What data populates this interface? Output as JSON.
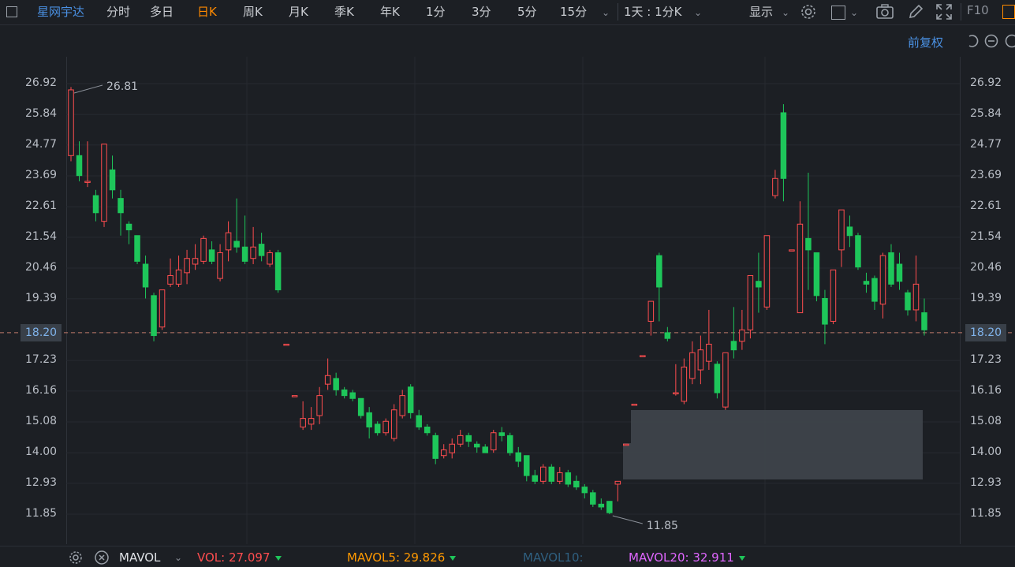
{
  "toolbar": {
    "stock_name": "星网宇达",
    "periods": [
      "分时",
      "多日",
      "日K",
      "周K",
      "月K",
      "季K",
      "年K",
      "1分",
      "3分",
      "5分",
      "15分"
    ],
    "active_period": "日K",
    "combo": "1天 : 1分K",
    "display": "显示",
    "f10": "F10"
  },
  "subbar": {
    "adjust": "前复权"
  },
  "price": {
    "current_label": "18.20",
    "ticks": [
      "26.92",
      "25.84",
      "24.77",
      "23.69",
      "22.61",
      "21.54",
      "20.46",
      "19.39",
      "18.20",
      "17.23",
      "16.16",
      "15.08",
      "14.00",
      "12.93",
      "11.85"
    ],
    "high_label": "26.81",
    "low_label": "11.85"
  },
  "indicator": {
    "name": "MAVOL",
    "vol_label": "VOL:",
    "vol_value": "27.097",
    "mavol5_label": "MAVOL5:",
    "mavol5_value": "29.826",
    "mavol10_label": "MAVOL10:",
    "mavol20_label": "MAVOL20:",
    "mavol20_value": "32.911"
  },
  "colors": {
    "up": "#ff4d4f",
    "down": "#1ec65a",
    "active": "#ff8a00",
    "stock": "#4a90e2",
    "mavol5": "#ff9900",
    "mavol10": "#2f5f7f",
    "mavol20": "#e066ff"
  },
  "chart_data": {
    "type": "candlestick",
    "ylim": [
      11.2,
      27.5
    ],
    "current_price": 18.2,
    "high": 26.81,
    "low": 11.85,
    "candles": [
      {
        "o": 24.4,
        "c": 26.7,
        "h": 26.8,
        "l": 24.2
      },
      {
        "o": 24.4,
        "c": 23.7,
        "h": 24.9,
        "l": 23.5
      },
      {
        "o": 23.5,
        "c": 23.5,
        "h": 24.9,
        "l": 23.3
      },
      {
        "o": 23.0,
        "c": 22.4,
        "h": 23.2,
        "l": 22.1
      },
      {
        "o": 22.1,
        "c": 24.8,
        "h": 24.8,
        "l": 21.9
      },
      {
        "o": 23.9,
        "c": 23.2,
        "h": 24.4,
        "l": 22.9
      },
      {
        "o": 22.9,
        "c": 22.4,
        "h": 23.2,
        "l": 21.6
      },
      {
        "o": 22.0,
        "c": 21.8,
        "h": 22.1,
        "l": 21.3
      },
      {
        "o": 21.6,
        "c": 20.7,
        "h": 21.6,
        "l": 20.6
      },
      {
        "o": 20.6,
        "c": 19.8,
        "h": 20.9,
        "l": 19.4
      },
      {
        "o": 19.5,
        "c": 18.1,
        "h": 19.6,
        "l": 17.9
      },
      {
        "o": 18.4,
        "c": 19.7,
        "h": 19.7,
        "l": 18.3
      },
      {
        "o": 19.9,
        "c": 20.2,
        "h": 20.8,
        "l": 19.8
      },
      {
        "o": 19.9,
        "c": 20.4,
        "h": 20.9,
        "l": 19.8
      },
      {
        "o": 20.3,
        "c": 20.8,
        "h": 21.1,
        "l": 19.9
      },
      {
        "o": 20.6,
        "c": 20.8,
        "h": 21.3,
        "l": 20.4
      },
      {
        "o": 20.7,
        "c": 21.5,
        "h": 21.6,
        "l": 20.6
      },
      {
        "o": 21.1,
        "c": 20.7,
        "h": 21.4,
        "l": 20.6
      },
      {
        "o": 20.1,
        "c": 21.0,
        "h": 21.3,
        "l": 20.0
      },
      {
        "o": 21.1,
        "c": 21.7,
        "h": 22.1,
        "l": 20.7
      },
      {
        "o": 21.4,
        "c": 21.2,
        "h": 22.9,
        "l": 21.0
      },
      {
        "o": 21.2,
        "c": 20.7,
        "h": 22.3,
        "l": 20.6
      },
      {
        "o": 20.8,
        "c": 21.2,
        "h": 21.9,
        "l": 20.6
      },
      {
        "o": 21.3,
        "c": 20.9,
        "h": 21.7,
        "l": 20.7
      },
      {
        "o": 20.6,
        "c": 21.0,
        "h": 21.1,
        "l": 20.5
      },
      {
        "o": 21.0,
        "c": 19.7,
        "h": 21.1,
        "l": 19.6
      },
      {
        "o": 17.8,
        "c": 17.8,
        "h": 17.8,
        "l": 17.8
      },
      {
        "o": 16.0,
        "c": 16.0,
        "h": 16.0,
        "l": 16.0
      },
      {
        "o": 14.9,
        "c": 15.2,
        "h": 15.8,
        "l": 14.8
      },
      {
        "o": 15.0,
        "c": 15.2,
        "h": 15.6,
        "l": 14.8
      },
      {
        "o": 15.3,
        "c": 16.0,
        "h": 16.3,
        "l": 15.0
      },
      {
        "o": 16.4,
        "c": 16.7,
        "h": 17.3,
        "l": 16.2
      },
      {
        "o": 16.6,
        "c": 16.2,
        "h": 16.8,
        "l": 16.0
      },
      {
        "o": 16.2,
        "c": 16.0,
        "h": 16.3,
        "l": 15.9
      },
      {
        "o": 16.1,
        "c": 15.9,
        "h": 16.2,
        "l": 15.8
      },
      {
        "o": 15.9,
        "c": 15.3,
        "h": 15.9,
        "l": 15.2
      },
      {
        "o": 15.4,
        "c": 14.9,
        "h": 15.6,
        "l": 14.5
      },
      {
        "o": 15.0,
        "c": 14.7,
        "h": 15.1,
        "l": 14.6
      },
      {
        "o": 14.7,
        "c": 15.1,
        "h": 15.2,
        "l": 14.6
      },
      {
        "o": 14.5,
        "c": 15.5,
        "h": 15.7,
        "l": 14.4
      },
      {
        "o": 15.3,
        "c": 16.0,
        "h": 16.2,
        "l": 15.2
      },
      {
        "o": 16.3,
        "c": 15.4,
        "h": 16.4,
        "l": 15.2
      },
      {
        "o": 15.3,
        "c": 14.9,
        "h": 15.5,
        "l": 14.8
      },
      {
        "o": 14.9,
        "c": 14.7,
        "h": 15.0,
        "l": 14.6
      },
      {
        "o": 14.6,
        "c": 13.8,
        "h": 14.7,
        "l": 13.6
      },
      {
        "o": 13.9,
        "c": 14.1,
        "h": 14.3,
        "l": 13.8
      },
      {
        "o": 14.0,
        "c": 14.3,
        "h": 14.5,
        "l": 13.8
      },
      {
        "o": 14.3,
        "c": 14.6,
        "h": 14.8,
        "l": 14.2
      },
      {
        "o": 14.6,
        "c": 14.4,
        "h": 14.7,
        "l": 14.2
      },
      {
        "o": 14.3,
        "c": 14.2,
        "h": 14.4,
        "l": 14.0
      },
      {
        "o": 14.2,
        "c": 14.0,
        "h": 14.3,
        "l": 14.0
      },
      {
        "o": 14.1,
        "c": 14.7,
        "h": 14.8,
        "l": 14.0
      },
      {
        "o": 14.7,
        "c": 14.6,
        "h": 14.9,
        "l": 14.4
      },
      {
        "o": 14.6,
        "c": 14.0,
        "h": 14.7,
        "l": 13.9
      },
      {
        "o": 14.0,
        "c": 13.7,
        "h": 14.2,
        "l": 13.5
      },
      {
        "o": 13.9,
        "c": 13.2,
        "h": 13.9,
        "l": 13.0
      },
      {
        "o": 13.2,
        "c": 13.0,
        "h": 13.4,
        "l": 12.9
      },
      {
        "o": 13.0,
        "c": 13.5,
        "h": 13.6,
        "l": 12.9
      },
      {
        "o": 13.5,
        "c": 13.0,
        "h": 13.6,
        "l": 12.9
      },
      {
        "o": 13.0,
        "c": 13.3,
        "h": 13.5,
        "l": 12.9
      },
      {
        "o": 13.3,
        "c": 12.9,
        "h": 13.4,
        "l": 12.8
      },
      {
        "o": 13.0,
        "c": 12.8,
        "h": 13.2,
        "l": 12.7
      },
      {
        "o": 12.8,
        "c": 12.6,
        "h": 12.9,
        "l": 12.4
      },
      {
        "o": 12.6,
        "c": 12.2,
        "h": 12.7,
        "l": 12.1
      },
      {
        "o": 12.2,
        "c": 12.1,
        "h": 12.4,
        "l": 12.0
      },
      {
        "o": 12.3,
        "c": 11.9,
        "h": 12.3,
        "l": 11.85
      },
      {
        "o": 12.9,
        "c": 13.0,
        "h": 13.0,
        "l": 12.3
      },
      {
        "o": 14.3,
        "c": 14.3,
        "h": 14.3,
        "l": 14.3
      },
      {
        "o": 15.7,
        "c": 15.7,
        "h": 15.7,
        "l": 15.7
      },
      {
        "o": 17.4,
        "c": 17.4,
        "h": 17.4,
        "l": 17.4
      },
      {
        "o": 18.6,
        "c": 19.3,
        "h": 19.3,
        "l": 18.1
      },
      {
        "o": 20.9,
        "c": 19.8,
        "h": 21.0,
        "l": 18.6
      },
      {
        "o": 18.2,
        "c": 18.0,
        "h": 18.4,
        "l": 17.9
      },
      {
        "o": 16.1,
        "c": 16.1,
        "h": 17.1,
        "l": 16.0
      },
      {
        "o": 15.8,
        "c": 17.0,
        "h": 17.3,
        "l": 15.7
      },
      {
        "o": 16.6,
        "c": 17.5,
        "h": 17.9,
        "l": 16.4
      },
      {
        "o": 16.9,
        "c": 17.6,
        "h": 18.1,
        "l": 16.4
      },
      {
        "o": 17.2,
        "c": 17.8,
        "h": 19.0,
        "l": 16.9
      },
      {
        "o": 17.1,
        "c": 16.1,
        "h": 17.2,
        "l": 15.9
      },
      {
        "o": 15.6,
        "c": 17.5,
        "h": 17.5,
        "l": 15.5
      },
      {
        "o": 17.9,
        "c": 17.6,
        "h": 19.1,
        "l": 17.3
      },
      {
        "o": 17.9,
        "c": 18.3,
        "h": 19.0,
        "l": 17.6
      },
      {
        "o": 18.3,
        "c": 20.2,
        "h": 20.2,
        "l": 18.0
      },
      {
        "o": 20.0,
        "c": 19.8,
        "h": 21.0,
        "l": 18.9
      },
      {
        "o": 19.1,
        "c": 21.6,
        "h": 21.6,
        "l": 19.0
      },
      {
        "o": 23.0,
        "c": 23.6,
        "h": 23.9,
        "l": 22.9
      },
      {
        "o": 25.9,
        "c": 23.6,
        "h": 26.2,
        "l": 22.8
      },
      {
        "o": 21.1,
        "c": 21.1,
        "h": 21.1,
        "l": 21.1
      },
      {
        "o": 18.9,
        "c": 22.0,
        "h": 22.8,
        "l": 18.9
      },
      {
        "o": 21.5,
        "c": 21.1,
        "h": 23.8,
        "l": 19.7
      },
      {
        "o": 21.0,
        "c": 19.5,
        "h": 21.0,
        "l": 19.3
      },
      {
        "o": 19.4,
        "c": 18.5,
        "h": 19.7,
        "l": 17.8
      },
      {
        "o": 18.6,
        "c": 20.4,
        "h": 20.4,
        "l": 18.5
      },
      {
        "o": 21.1,
        "c": 22.5,
        "h": 22.5,
        "l": 20.5
      },
      {
        "o": 21.9,
        "c": 21.6,
        "h": 22.3,
        "l": 21.2
      },
      {
        "o": 21.6,
        "c": 20.5,
        "h": 21.7,
        "l": 20.4
      },
      {
        "o": 20.0,
        "c": 19.9,
        "h": 20.3,
        "l": 19.6
      },
      {
        "o": 20.1,
        "c": 19.3,
        "h": 20.2,
        "l": 19.0
      },
      {
        "o": 19.2,
        "c": 20.9,
        "h": 21.0,
        "l": 18.7
      },
      {
        "o": 21.0,
        "c": 19.9,
        "h": 21.3,
        "l": 19.8
      },
      {
        "o": 20.6,
        "c": 20.0,
        "h": 21.0,
        "l": 19.7
      },
      {
        "o": 19.6,
        "c": 19.0,
        "h": 19.7,
        "l": 18.8
      },
      {
        "o": 19.0,
        "c": 19.9,
        "h": 20.9,
        "l": 18.6
      },
      {
        "o": 18.9,
        "c": 18.3,
        "h": 19.4,
        "l": 18.1
      }
    ]
  }
}
